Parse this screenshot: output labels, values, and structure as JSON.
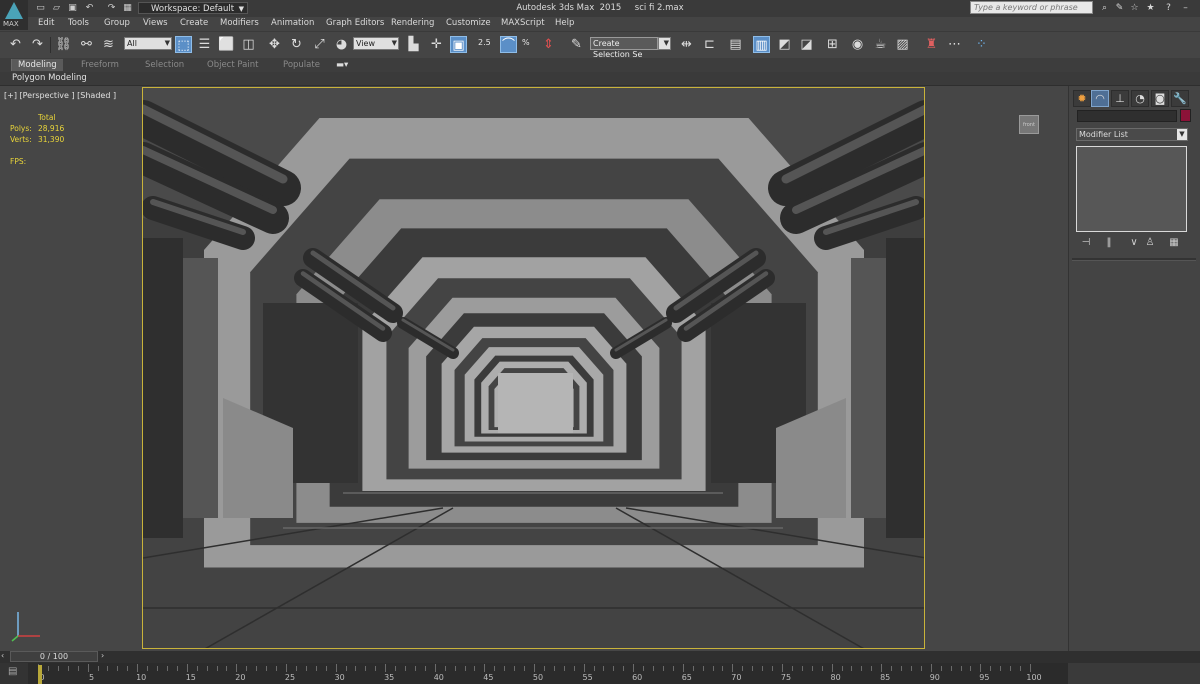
{
  "app": {
    "logo_text": "MAX",
    "workspace": "Workspace: Default",
    "title": "Autodesk 3ds Max  2015     sci fi 2.max",
    "search_placeholder": "Type a keyword or phrase"
  },
  "quick_access": [
    "new-file-icon",
    "open-file-icon",
    "save-icon",
    "undo-icon",
    "redo-icon",
    "project-folder-icon"
  ],
  "menu": [
    "Edit",
    "Tools",
    "Group",
    "Views",
    "Create",
    "Modifiers",
    "Animation",
    "Graph Editors",
    "Rendering",
    "Customize",
    "MAXScript",
    "Help"
  ],
  "toolbar": {
    "selection_filter": "All",
    "reference_coord": "View",
    "named_selection": "Create Selection Se",
    "angle_snap_label": "2.5",
    "percent_snap_label": "%"
  },
  "ribbon": {
    "tabs": [
      "Modeling",
      "Freeform",
      "Selection",
      "Object Paint",
      "Populate"
    ],
    "active_tab": "Modeling",
    "sub_label": "Polygon Modeling"
  },
  "viewport": {
    "label": "[+] [Perspective ] [Shaded ]",
    "stats": {
      "total_label": "Total",
      "polys_label": "Polys:",
      "polys_value": "28,916",
      "verts_label": "Verts:",
      "verts_value": "31,390",
      "fps_label": "FPS:"
    },
    "viewcube_label": "front"
  },
  "command_panel": {
    "tabs": [
      "create-icon",
      "modify-icon",
      "hierarchy-icon",
      "motion-icon",
      "display-icon",
      "utilities-icon"
    ],
    "active_tab": "modify-icon",
    "object_color": "#8c1238",
    "modifier_list_label": "Modifier List"
  },
  "timeline": {
    "frame_display": "0 / 100",
    "ticks": [
      "0",
      "5",
      "10",
      "15",
      "20",
      "25",
      "30",
      "35",
      "40",
      "45",
      "50",
      "55",
      "60",
      "65",
      "70",
      "75",
      "80",
      "85",
      "90",
      "95",
      "100"
    ]
  },
  "colors": {
    "viewport_border": "#c9b33a",
    "stats_text": "#e8d43a",
    "highlight_button": "#5b8fc7"
  }
}
